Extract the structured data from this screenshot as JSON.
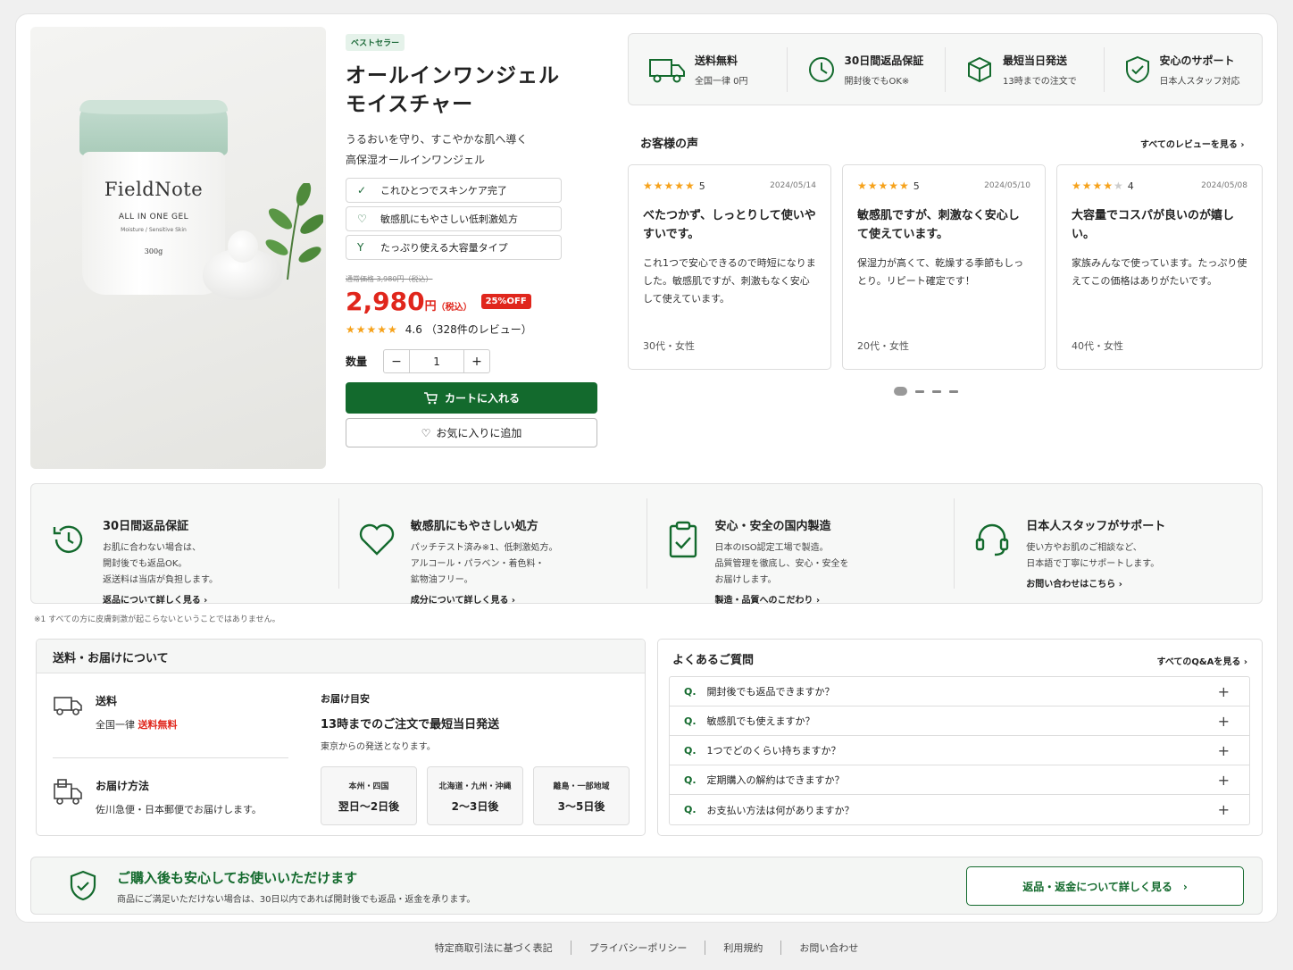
{
  "product": {
    "badge": "ベストセラー",
    "title_line1": "オールインワンジェル",
    "title_line2": "モイスチャー",
    "desc_line1": "うるおいを守り、すこやかな肌へ導く",
    "desc_line2": "高保湿オールインワンジェル",
    "features": [
      "これひとつでスキンケア完了",
      "敏感肌にもやさしい低刺激処方",
      "たっぷり使える大容量タイプ"
    ],
    "old_price": "通常価格 3,980円（税込）",
    "price": "2,980",
    "price_unit": "円",
    "price_tax": "（税込）",
    "discount": "25%OFF",
    "rating_score": "4.6",
    "rating_count": "（328件のレビュー）",
    "qty_label": "数量",
    "qty_value": "1",
    "minus": "−",
    "plus": "+",
    "cart_label": "カートに入れる",
    "fav_label": "お気に入りに追加",
    "jar_brand": "FieldNote",
    "jar_line1": "ALL IN ONE GEL",
    "jar_line2": "Moisture / Sensitive Skin",
    "jar_line3": "300g"
  },
  "benefits": [
    {
      "title": "送料無料",
      "sub": "全国一律 0円"
    },
    {
      "title": "30日間返品保証",
      "sub": "開封後でもOK※"
    },
    {
      "title": "最短当日発送",
      "sub": "13時までの注文で"
    },
    {
      "title": "安心のサポート",
      "sub": "日本人スタッフ対応"
    }
  ],
  "reviews_section": {
    "heading": "お客様の声",
    "see_all": "すべてのレビューを見る ›",
    "items": [
      {
        "stars": 5,
        "score": "5",
        "date": "2024/05/14",
        "title": "べたつかず、しっとりして使いやすいです。",
        "body": "これ1つで安心できるので時短になりました。敏感肌ですが、刺激もなく安心して使えています。",
        "meta": "30代・女性"
      },
      {
        "stars": 5,
        "score": "5",
        "date": "2024/05/10",
        "title": "敏感肌ですが、刺激なく安心して使えています。",
        "body": "保湿力が高くて、乾燥する季節もしっとり。リピート確定です！",
        "meta": "20代・女性"
      },
      {
        "stars": 4,
        "score": "4",
        "date": "2024/05/08",
        "title": "大容量でコスパが良いのが嬉しい。",
        "body": "家族みんなで使っています。たっぷり使えてこの価格はありがたいです。",
        "meta": "40代・女性"
      }
    ]
  },
  "assurances": [
    {
      "title": "30日間返品保証",
      "body": [
        "お肌に合わない場合は、",
        "開封後でも返品OK。",
        "返送料は当店が負担します。"
      ],
      "link": "返品について詳しく見る ›"
    },
    {
      "title": "敏感肌にもやさしい処方",
      "body": [
        "パッチテスト済み※1、低刺激処方。",
        "アルコール・パラベン・着色料・",
        "鉱物油フリー。"
      ],
      "link": "成分について詳しく見る ›"
    },
    {
      "title": "安心・安全の国内製造",
      "body": [
        "日本のISO認定工場で製造。",
        "品質管理を徹底し、安心・安全を",
        "お届けします。"
      ],
      "link": "製造・品質へのこだわり ›"
    },
    {
      "title": "日本人スタッフがサポート",
      "body": [
        "使い方やお肌のご相談など、",
        "日本語で丁寧にサポートします。"
      ],
      "link": "お問い合わせはこちら ›"
    }
  ],
  "note": "※1 すべての方に皮膚刺激が起こらないということではありません。",
  "shipping": {
    "heading": "送料・お届けについて",
    "fee_label": "送料",
    "fee_prefix": "全国一律",
    "fee_value": "送料無料",
    "method_label": "お届け方法",
    "method_value": "佐川急便・日本郵便でお届けします。",
    "eta_label": "お届け目安",
    "eta_title": "13時までのご注文で最短当日発送",
    "eta_sub": "東京からの発送となります。",
    "zones": [
      {
        "name": "本州・四国",
        "days": "翌日〜2日後"
      },
      {
        "name": "北海道・九州・沖縄",
        "days": "2〜3日後"
      },
      {
        "name": "離島・一部地域",
        "days": "3〜5日後"
      }
    ]
  },
  "faq": {
    "heading": "よくあるご質問",
    "see_all": "すべてのQ&Aを見る ›",
    "q_mark": "Q.",
    "items": [
      "開封後でも返品できますか？",
      "敏感肌でも使えますか？",
      "1つでどのくらい持ちますか？",
      "定期購入の解約はできますか？",
      "お支払い方法は何がありますか？"
    ]
  },
  "peace": {
    "title": "ご購入後も安心してお使いいただけます",
    "sub": "商品にご満足いただけない場合は、30日以内であれば開封後でも返品・返金を承ります。",
    "button": "返品・返金について詳しく見る　›"
  },
  "footer": [
    "特定商取引法に基づく表記",
    "プライバシーポリシー",
    "利用規約",
    "お問い合わせ"
  ],
  "colors": {
    "accent": "#136a2d",
    "sale": "#e0261c",
    "star": "#f6a21b"
  }
}
